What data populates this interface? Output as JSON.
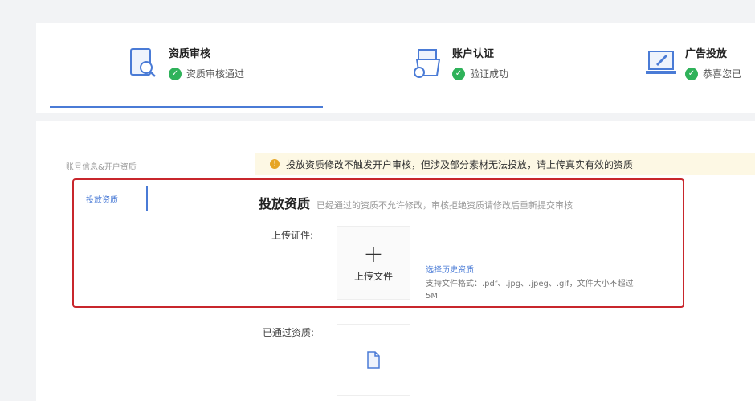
{
  "steps": [
    {
      "title": "资质审核",
      "status": "资质审核通过",
      "icon": "document-search-icon"
    },
    {
      "title": "账户认证",
      "status": "验证成功",
      "icon": "folder-lock-icon"
    },
    {
      "title": "广告投放",
      "status": "恭喜您已",
      "icon": "laptop-rocket-icon"
    }
  ],
  "notice": "投放资质修改不触发开户审核，但涉及部分素材无法投放，请上传真实有效的资质",
  "sidebar": {
    "group": "账号信息&开户资质",
    "active": "投放资质"
  },
  "section": {
    "title": "投放资质",
    "subtitle": "已经通过的资质不允许修改，审核拒绝资质请修改后重新提交审核"
  },
  "upload": {
    "label": "上传证件:",
    "button": "上传文件",
    "history_link": "选择历史资质",
    "hint": "支持文件格式：.pdf、.jpg、.jpeg、.gif，文件大小不超过5M"
  },
  "approved": {
    "label": "已通过资质:"
  },
  "colors": {
    "accent": "#4a7bd6",
    "success": "#2fb25a",
    "warning": "#e6a524",
    "highlight": "#c8262c"
  }
}
